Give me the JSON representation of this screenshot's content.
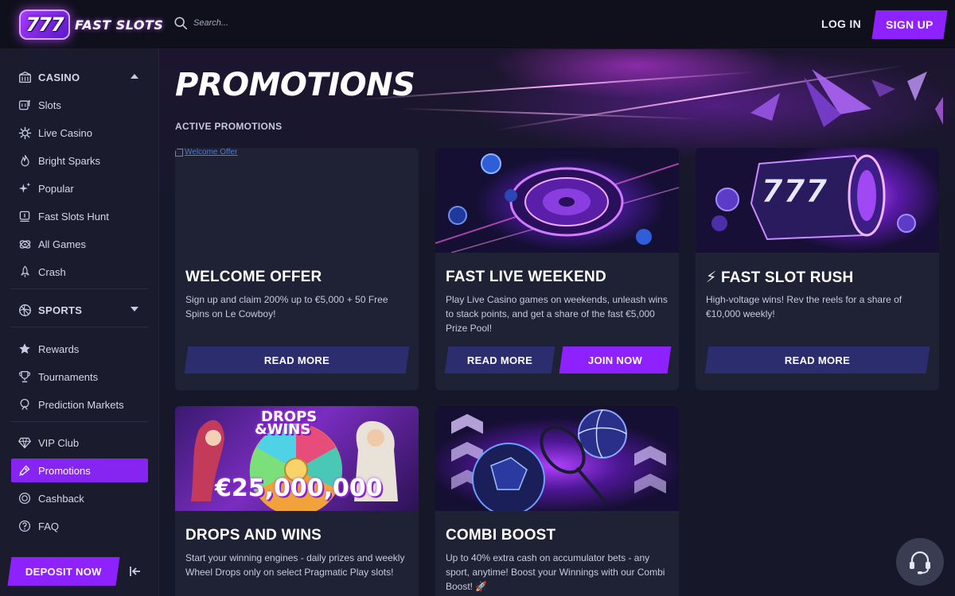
{
  "header": {
    "logo_badge": "777",
    "logo_text": "FAST SLOTS",
    "search_placeholder": "Search...",
    "login_label": "LOG IN",
    "signup_label": "SIGN UP"
  },
  "sidebar": {
    "casino_label": "CASINO",
    "casino_items": [
      {
        "label": "Slots",
        "icon": "slot-machine-icon"
      },
      {
        "label": "Live Casino",
        "icon": "live-casino-icon"
      },
      {
        "label": "Bright Sparks",
        "icon": "flame-icon"
      },
      {
        "label": "Popular",
        "icon": "sparkle-icon"
      },
      {
        "label": "Fast Slots Hunt",
        "icon": "hunt-icon"
      },
      {
        "label": "All Games",
        "icon": "all-games-icon"
      },
      {
        "label": "Crash",
        "icon": "rocket-icon"
      }
    ],
    "sports_label": "SPORTS",
    "extra_items": [
      {
        "label": "Rewards",
        "icon": "star-icon"
      },
      {
        "label": "Tournaments",
        "icon": "trophy-icon"
      },
      {
        "label": "Prediction Markets",
        "icon": "prediction-icon"
      }
    ],
    "club_items": [
      {
        "label": "VIP Club",
        "icon": "diamond-icon"
      },
      {
        "label": "Promotions",
        "icon": "promotions-icon",
        "active": true
      },
      {
        "label": "Cashback",
        "icon": "cashback-icon"
      },
      {
        "label": "FAQ",
        "icon": "faq-icon"
      }
    ],
    "deposit_label": "DEPOSIT NOW"
  },
  "main": {
    "title": "PROMOTIONS",
    "section_label": "ACTIVE PROMOTIONS",
    "cards": [
      {
        "title": "WELCOME OFFER",
        "description": "Sign up and claim 200% up to €5,000 + 50 Free Spins on Le Cowboy!",
        "image_alt": "Welcome Offer",
        "buttons": [
          "READ MORE"
        ]
      },
      {
        "title": "FAST LIVE WEEKEND",
        "description": "Play Live Casino games on weekends, unleash wins to stack points, and get a share of the fast €5,000 Prize Pool!",
        "buttons": [
          "READ MORE",
          "JOIN NOW"
        ]
      },
      {
        "title": "⚡ FAST SLOT RUSH",
        "description": "High-voltage wins! Rev the reels for a share of €10,000 weekly!",
        "buttons": [
          "READ MORE"
        ]
      },
      {
        "title": "DROPS AND WINS",
        "description": "Start your winning engines - daily prizes and weekly Wheel Drops only on select Pragmatic Play slots!",
        "image_text_top": "DROPS",
        "image_text_mid": "&WINS",
        "image_amount": "€25,000,000"
      },
      {
        "title": "COMBI BOOST",
        "description": "Up to 40% extra cash on accumulator bets - any sport, anytime! Boost your Winnings with our Combi Boost! 🚀"
      }
    ]
  },
  "colors": {
    "accent": "#8d22ff",
    "dark_button": "#2c2d6e",
    "background": "#16182a",
    "card": "#1f2134"
  }
}
